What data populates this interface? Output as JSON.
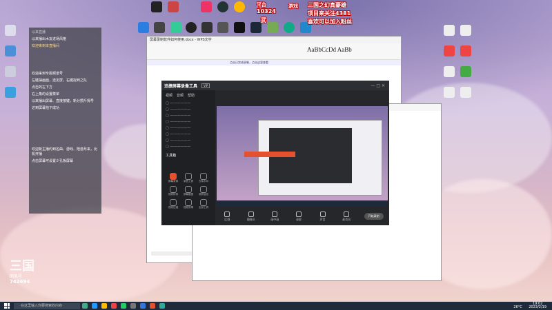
{
  "overlay": {
    "line1": "三国之幻真豪雄",
    "line2": "项目来关注4381",
    "line3": "喜欢可以加入粉丝",
    "sub1": "平台",
    "sub2": "10324",
    "sub3": "武",
    "sub4": "游戏"
  },
  "badge": {
    "logo": "三国",
    "sub": "国风号",
    "number": "742694"
  },
  "chat": {
    "header": "以来直播",
    "rows": [
      "以来播出木友进场风格",
      "欢迎来到本直播间",
      "欢迎来到专属频道号",
      "左键抽画面，选定屏，右键捉到之队",
      "点击的左下方",
      "右上角的设置菜单",
      "以来播出屏幕、直接按键，新分攒斤拇号",
      "达到屏幕拍下成功",
      "欢迎新主播约到名曲、游戏、陪游月来，比机开播",
      "点击屏幕可设置少孔板屏幕"
    ]
  },
  "recorder": {
    "title": "迅捷屏幕录像工具",
    "badge": "VIP",
    "tabs": [
      "视频",
      "音频",
      "帮助"
    ],
    "tools_label": "工具箱",
    "tools": [
      "屏幕录像",
      "录音工具",
      "去除水印",
      "视频转换",
      "屏幕截图",
      "录屏监控",
      "视频压缩",
      "视频剪辑",
      "全部工具"
    ],
    "bottom_buttons": [
      "区域",
      "摄像头",
      "画中画",
      "录屏",
      "声音",
      "麦克风"
    ],
    "start": "开始录制"
  },
  "doc": {
    "title": "屏幕录制软件如何使用.docx - WPS文字",
    "notice": "点击已完成录制，点击这里查看"
  },
  "taskbar": {
    "search_placeholder": "在这里输入你要搜索的内容",
    "time": "19:02",
    "date": "2023/2/19",
    "temp": "26°C"
  },
  "icons": [
    "recycle-bin-icon",
    "qq-icon",
    "wechat-icon",
    "chrome-icon",
    "edge-icon",
    "music-icon",
    "game-icon",
    "epic-icon",
    "steam-icon"
  ]
}
